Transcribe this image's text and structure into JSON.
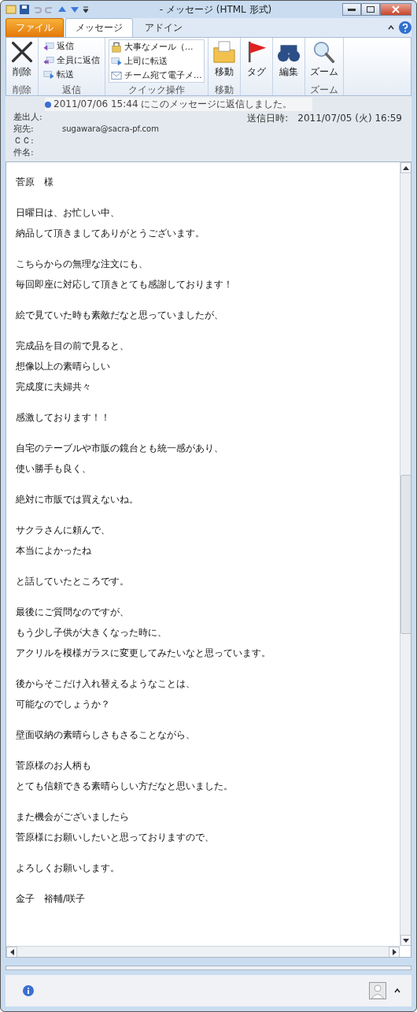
{
  "window": {
    "title": "- メッセージ (HTML 形式)"
  },
  "tabs": [
    {
      "label": "ファイル",
      "kind": "file",
      "selected": false
    },
    {
      "label": "メッセージ",
      "kind": "tab",
      "selected": true
    },
    {
      "label": "アドイン",
      "kind": "tab",
      "selected": false
    }
  ],
  "ribbon": {
    "groups": [
      {
        "label": "削除",
        "large": [
          {
            "label": "削除"
          }
        ]
      },
      {
        "label": "返信",
        "small": [
          {
            "label": "返信"
          },
          {
            "label": "全員に返信"
          },
          {
            "label": "転送"
          }
        ]
      },
      {
        "label": "クイック操作",
        "small": [
          {
            "label": "大事なメール（..."
          },
          {
            "label": "上司に転送"
          },
          {
            "label": "チーム宛て電子メ..."
          }
        ]
      },
      {
        "label": "移動",
        "large": [
          {
            "label": "移動"
          }
        ]
      },
      {
        "large": [
          {
            "label": "タグ"
          }
        ]
      },
      {
        "large": [
          {
            "label": "編集"
          }
        ]
      },
      {
        "label": "ズーム",
        "large": [
          {
            "label": "ズーム"
          }
        ]
      }
    ]
  },
  "header": {
    "info": "2011/07/06 15:44 にこのメッセージに返信しました。",
    "fields": [
      {
        "label": "差出人:"
      },
      {
        "label": "宛先:",
        "value": "sugawara@sacra-pf.com"
      },
      {
        "label": "ＣＣ:"
      },
      {
        "label": "件名:"
      }
    ],
    "sent_label": "送信日時:",
    "sent_value": "2011/07/05 (火) 16:59"
  },
  "body": {
    "paragraphs": [
      {
        "lines": [
          "菅原　様"
        ]
      },
      {
        "lines": [
          "日曜日は、お忙しい中、",
          "納品して頂きましてありがとうございます。"
        ]
      },
      {
        "lines": [
          "こちらからの無理な注文にも、",
          "毎回即座に対応して頂きとても感謝しております！"
        ]
      },
      {
        "lines": [
          "絵で見ていた時も素敵だなと思っていましたが、"
        ]
      },
      {
        "lines": [
          "完成品を目の前で見ると、",
          "想像以上の素晴らしい",
          "完成度に夫婦共々"
        ]
      },
      {
        "lines": [
          "感激しております！！"
        ]
      },
      {
        "lines": [
          "自宅のテーブルや市販の鏡台とも統一感があり、",
          "使い勝手も良く、"
        ]
      },
      {
        "lines": [
          "絶対に市販では買えないね。"
        ]
      },
      {
        "lines": [
          "サクラさんに頼んで、",
          "本当によかったね"
        ]
      },
      {
        "lines": [
          "と話していたところです。"
        ]
      },
      {
        "lines": [
          "最後にご質問なのですが、",
          "もう少し子供が大きくなった時に、",
          "アクリルを模様ガラスに変更してみたいなと思っています。"
        ]
      },
      {
        "lines": [
          "後からそこだけ入れ替えるようなことは、",
          "可能なのでしょうか？"
        ]
      },
      {
        "lines": [
          "壁面収納の素晴らしさもさることながら、"
        ]
      },
      {
        "lines": [
          "菅原様のお人柄も",
          "とても信頼できる素晴らしい方だなと思いました。"
        ]
      },
      {
        "lines": [
          "また機会がございましたら",
          "菅原様にお願いしたいと思っておりますので、"
        ]
      },
      {
        "lines": [
          "よろしくお願いします。"
        ]
      },
      {
        "lines": [
          "金子　裕輔/咲子"
        ]
      }
    ]
  }
}
